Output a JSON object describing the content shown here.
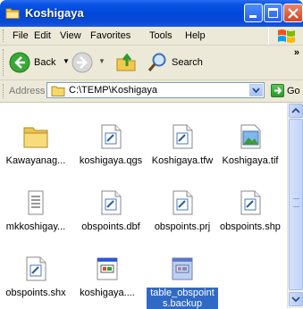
{
  "window": {
    "title": "Koshigaya"
  },
  "menu": {
    "file": "File",
    "edit": "Edit",
    "view": "View",
    "favorites": "Favorites",
    "tools": "Tools",
    "help": "Help"
  },
  "toolbar": {
    "back_label": "Back",
    "search_label": "Search",
    "more": "»"
  },
  "address": {
    "label": "Address",
    "path": "C:\\TEMP\\Koshigaya",
    "go_label": "Go"
  },
  "files": [
    {
      "name": "Kawayanag...",
      "kind": "folder"
    },
    {
      "name": "koshigaya.qgs",
      "kind": "generic"
    },
    {
      "name": "Koshigaya.tfw",
      "kind": "generic"
    },
    {
      "name": "Koshigaya.tif",
      "kind": "image"
    },
    {
      "name": "mkkoshigay...",
      "kind": "text"
    },
    {
      "name": "obspoints.dbf",
      "kind": "generic"
    },
    {
      "name": "obspoints.prj",
      "kind": "generic"
    },
    {
      "name": "obspoints.shp",
      "kind": "generic"
    },
    {
      "name": "obspoints.shx",
      "kind": "generic"
    },
    {
      "name": "koshigaya....",
      "kind": "app"
    },
    {
      "name": "table_obspoints.backup",
      "kind": "app",
      "selected": true
    }
  ],
  "colors": {
    "titlebar": "#0047d8",
    "selection": "#316ac5",
    "chrome": "#ece9d8"
  }
}
